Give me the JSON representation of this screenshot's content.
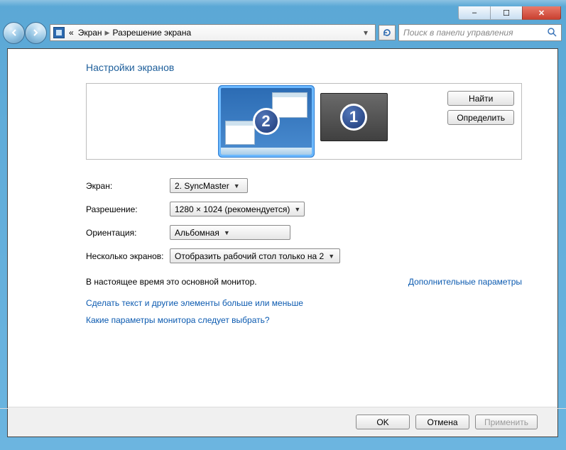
{
  "titlebar": {
    "min_glyph": "–",
    "max_glyph": "☐",
    "close_glyph": "✕"
  },
  "breadcrumb": {
    "prefix": "«",
    "item1": "Экран",
    "item2": "Разрешение экрана"
  },
  "search": {
    "placeholder": "Поиск в панели управления"
  },
  "page_title": "Настройки экранов",
  "side_buttons": {
    "find": "Найти",
    "identify": "Определить"
  },
  "monitors": {
    "primary_num": "2",
    "secondary_num": "1"
  },
  "form": {
    "screen_label": "Экран:",
    "screen_value": "2. SyncMaster",
    "resolution_label": "Разрешение:",
    "resolution_value": "1280 × 1024 (рекомендуется)",
    "orientation_label": "Ориентация:",
    "orientation_value": "Альбомная",
    "multi_label": "Несколько экранов:",
    "multi_value": "Отобразить рабочий стол только на 2"
  },
  "status": {
    "text": "В настоящее время это основной монитор.",
    "adv_link": "Дополнительные параметры"
  },
  "links": {
    "text_size": "Сделать текст и другие элементы больше или меньше",
    "which_params": "Какие параметры монитора следует выбрать?"
  },
  "footer": {
    "ok": "OK",
    "cancel": "Отмена",
    "apply": "Применить"
  }
}
